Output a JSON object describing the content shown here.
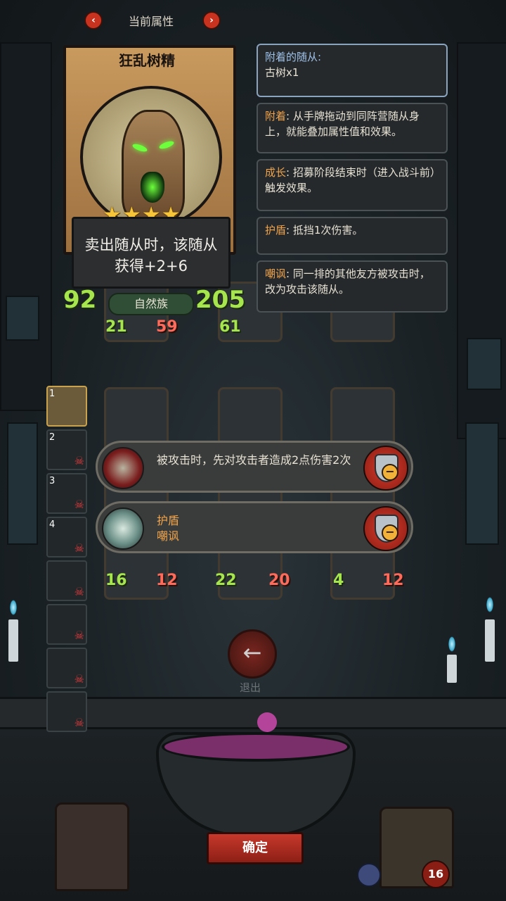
{
  "header": {
    "title": "当前属性",
    "prev_icon": "chevron-left-icon",
    "next_icon": "chevron-right-icon",
    "prev_glyph": "‹",
    "next_glyph": "›"
  },
  "card": {
    "name": "狂乱树精",
    "stars": "★★★★",
    "description": "卖出随从时，该随从获得+2+6",
    "attack": "92",
    "health": "205",
    "tribe": "自然族"
  },
  "info_panels": [
    {
      "key": "附着的随从:",
      "text": "古树x1"
    },
    {
      "key": "附着",
      "text": ": 从手牌拖动到同阵营随从身上，就能叠加属性值和效果。"
    },
    {
      "key": "成长",
      "text": ": 招募阶段结束时（进入战斗前）触发效果。"
    },
    {
      "key": "护盾",
      "text": ": 抵挡1次伤害。"
    },
    {
      "key": "嘲讽",
      "text": ": 同一排的其他友方被攻击时，改为攻击该随从。"
    }
  ],
  "board_top": {
    "numbers": [
      "21",
      "59",
      "61"
    ]
  },
  "board_bottom": {
    "numbers": [
      "16",
      "12",
      "22",
      "20",
      "4",
      "12"
    ]
  },
  "side_list": {
    "items": [
      "1",
      "2",
      "3",
      "4",
      "",
      "",
      "",
      ""
    ]
  },
  "effects": [
    {
      "text": "被攻击时，先对攻击者造成2点伤害2次",
      "icon": "hooded-figure-icon"
    },
    {
      "text": "护盾\n嘲讽",
      "icon": "ghost-tree-icon"
    }
  ],
  "exit": {
    "label": "退出",
    "glyph": "←"
  },
  "confirm": {
    "label": "确定"
  },
  "corner_right": {
    "badge": "16"
  }
}
